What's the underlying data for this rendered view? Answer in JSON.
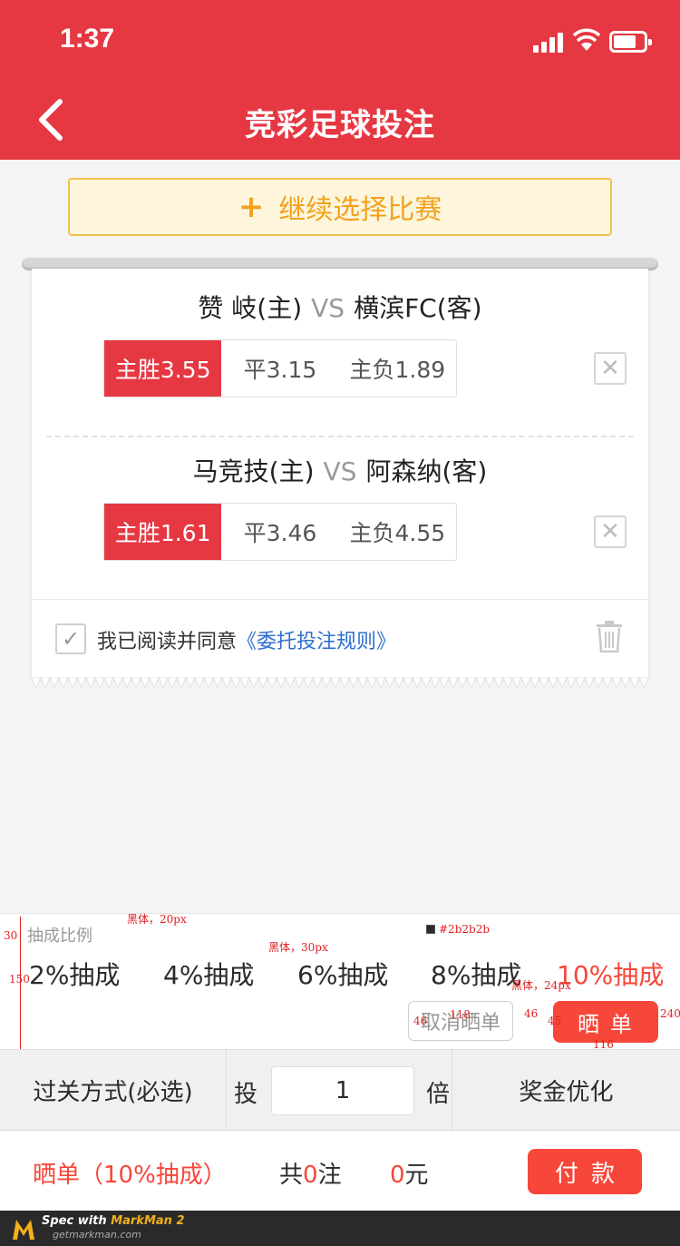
{
  "status": {
    "time": "1:37"
  },
  "nav": {
    "title": "竞彩足球投注"
  },
  "continue_button": {
    "label": "继续选择比赛"
  },
  "matches": [
    {
      "home": "赞 岐(主)",
      "vs": "VS",
      "away": "横滨FC(客)",
      "odds": [
        {
          "label": "主胜3.55",
          "selected": true
        },
        {
          "label": "平3.15",
          "selected": false
        },
        {
          "label": "主负1.89",
          "selected": false
        }
      ]
    },
    {
      "home": "马竞技(主)",
      "vs": "VS",
      "away": "阿森纳(客)",
      "odds": [
        {
          "label": "主胜1.61",
          "selected": true
        },
        {
          "label": "平3.46",
          "selected": false
        },
        {
          "label": "主负4.55",
          "selected": false
        }
      ]
    }
  ],
  "agreement": {
    "text": "我已阅读并同意",
    "link": "《委托投注规则》",
    "checked": true
  },
  "commission": {
    "label": "抽成比例",
    "options": [
      "2%抽成",
      "4%抽成",
      "6%抽成",
      "8%抽成",
      "10%抽成"
    ],
    "active_index": 4,
    "cancel_label": "取消晒单",
    "share_label": "晒单"
  },
  "spec_notes": {
    "font_label": "黑体，20px",
    "font_option": "黑体，30px",
    "font_button": "黑体，24px",
    "color_text": "#2b2b2b",
    "color_cancel": "#969696",
    "color_accent": "#f7463a",
    "dim_30": "30",
    "dim_150": "150",
    "dim_118": "118",
    "dim_46a": "46",
    "dim_46b": "46",
    "dim_45": "45",
    "dim_116": "116",
    "dim_240": "240"
  },
  "pass_bar": {
    "pass_type": "过关方式(必选)",
    "bet_label": "投",
    "multiplier": "1",
    "multiplier_unit": "倍",
    "optimize": "奖金优化"
  },
  "footer": {
    "share_note": "晒单（10%抽成）",
    "total_prefix": "共",
    "total_count": "0",
    "total_suffix": "注",
    "amount_value": "0",
    "amount_unit": "元",
    "pay_label": "付款"
  },
  "markman": {
    "spec_with": "Spec with",
    "brand": "MarkMan 2",
    "site": "getmarkman.com"
  },
  "colors": {
    "primary": "#e63843",
    "accent": "#f7463a",
    "link": "#2f6fcf",
    "warning": "#f3a11d"
  },
  "icons": [
    "back-icon",
    "plus-icon",
    "close-icon",
    "check-icon",
    "trash-icon",
    "signal-icon",
    "wifi-icon",
    "battery-icon"
  ]
}
